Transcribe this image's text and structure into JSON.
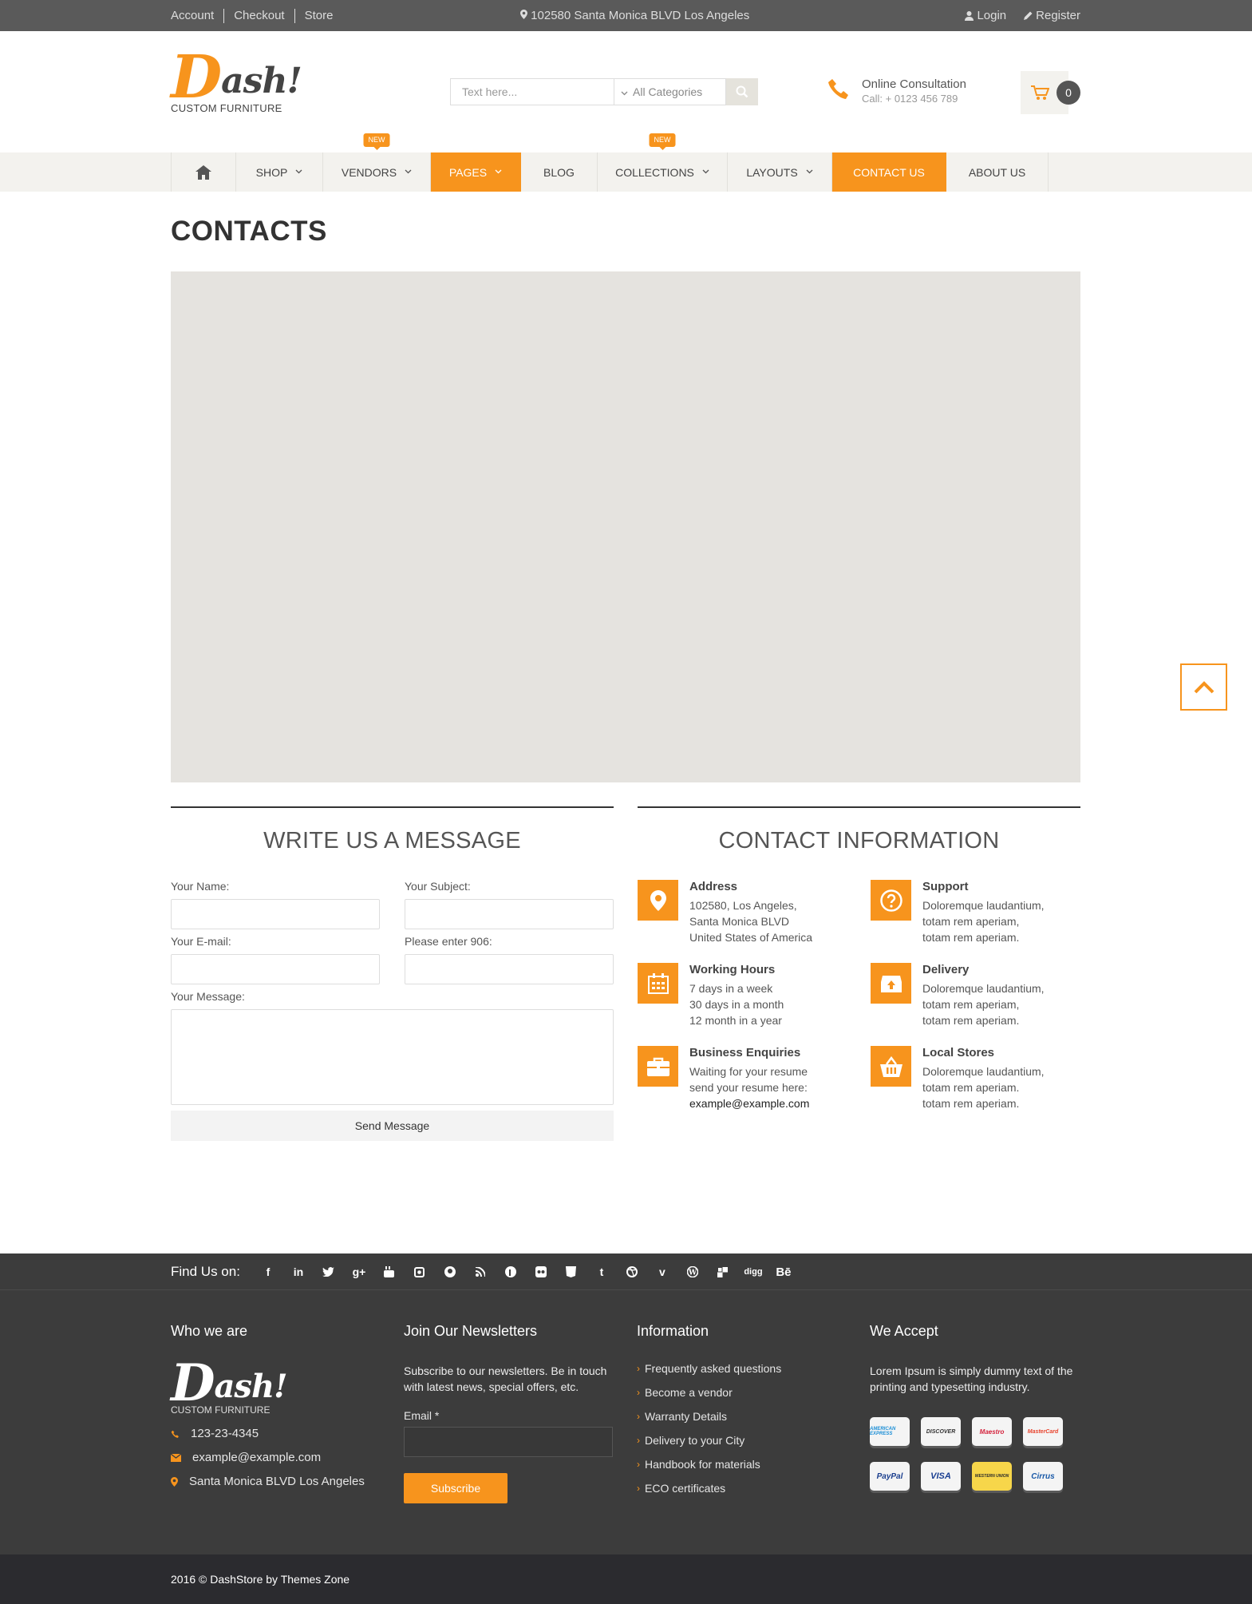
{
  "topbar": {
    "links": [
      "Account",
      "Checkout",
      "Store"
    ],
    "address": "102580 Santa Monica BLVD Los Angeles",
    "login": "Login",
    "register": "Register"
  },
  "header": {
    "logo_big": "D",
    "logo_rest": "ash!",
    "logo_sub": "CUSTOM FURNITURE",
    "search_placeholder": "Text here...",
    "category": "All Categories",
    "consult_title": "Online Consultation",
    "consult_phone": "Call: + 0123 456 789",
    "cart_count": "0"
  },
  "nav": {
    "items": [
      {
        "label": "SHOP",
        "badge": ""
      },
      {
        "label": "VENDORS",
        "badge": "NEW"
      },
      {
        "label": "PAGES",
        "badge": ""
      },
      {
        "label": "BLOG",
        "badge": ""
      },
      {
        "label": "COLLECTIONS",
        "badge": "NEW"
      },
      {
        "label": "LAYOUTS",
        "badge": ""
      },
      {
        "label": "CONTACT US",
        "badge": ""
      },
      {
        "label": "ABOUT US",
        "badge": ""
      }
    ]
  },
  "page": {
    "title": "CONTACTS"
  },
  "form": {
    "title": "WRITE US A MESSAGE",
    "name_label": "Your Name:",
    "subject_label": "Your Subject:",
    "email_label": "Your E-mail:",
    "captcha_label": "Please enter 906:",
    "message_label": "Your Message:",
    "send_label": "Send Message"
  },
  "contact_info": {
    "title": "CONTACT INFORMATION",
    "blocks": [
      {
        "title": "Address",
        "lines": [
          "102580, Los Angeles,",
          "Santa Monica BLVD",
          "United States of America"
        ]
      },
      {
        "title": "Support",
        "lines": [
          "Doloremque laudantium,",
          "totam rem aperiam,",
          "totam rem aperiam."
        ]
      },
      {
        "title": "Working Hours",
        "lines": [
          "7 days in a week",
          "30 days in a month",
          "12 month in a year"
        ]
      },
      {
        "title": "Delivery",
        "lines": [
          "Doloremque laudantium,",
          "totam rem aperiam,",
          "totam rem aperiam."
        ]
      },
      {
        "title": "Business Enquiries",
        "lines": [
          "Waiting for your resume",
          "send your resume here:",
          "example@example.com"
        ]
      },
      {
        "title": "Local Stores",
        "lines": [
          "Doloremque laudantium,",
          "totam rem aperiam.",
          "totam rem aperiam."
        ]
      }
    ]
  },
  "social": {
    "label": "Find Us on:",
    "icons": [
      "facebook-icon",
      "linkedin-icon",
      "twitter-icon",
      "google-plus-icon",
      "youtube-icon",
      "instagram-icon",
      "github-icon",
      "rss-icon",
      "pinterest-icon",
      "flickr-icon",
      "stack-icon",
      "tumblr-icon",
      "dribbble-icon",
      "vimeo-icon",
      "wordpress-icon",
      "delicious-icon",
      "digg-icon",
      "behance-icon"
    ]
  },
  "footer": {
    "who_title": "Who we are",
    "logo_sub": "CUSTOM FURNITURE",
    "phone": "123-23-4345",
    "email": "example@example.com",
    "address": "Santa Monica BLVD Los Angeles",
    "news_title": "Join Our Newsletters",
    "news_text": "Subscribe to our newsletters. Be in touch with latest news, special offers, etc.",
    "email_label": "Email *",
    "subscribe": "Subscribe",
    "info_title": "Information",
    "info_links": [
      "Frequently asked questions",
      "Become a vendor",
      "Warranty Details",
      "Delivery to your City",
      "Handbook for materials",
      "ECO certificates"
    ],
    "accept_title": "We Accept",
    "accept_text": "Lorem Ipsum is simply dummy text of the printing and typesetting industry.",
    "cards": [
      {
        "name": "AMERICAN EXPRESS",
        "color": "#1d8fd6"
      },
      {
        "name": "DISCOVER",
        "color": "#f18a1f"
      },
      {
        "name": "Maestro",
        "color": "#d4213b"
      },
      {
        "name": "MasterCard",
        "color": "#e8432d"
      },
      {
        "name": "PayPal",
        "color": "#1b3f8e"
      },
      {
        "name": "VISA",
        "color": "#1a3f92"
      },
      {
        "name": "WESTERN UNION",
        "color": "#2b2b2b"
      },
      {
        "name": "Cirrus",
        "color": "#1a5aa8"
      }
    ]
  },
  "bottom": {
    "copyright": "2016 © DashStore by Themes Zone"
  },
  "colors": {
    "accent": "#f7941d",
    "dark": "#3c3c3c"
  }
}
